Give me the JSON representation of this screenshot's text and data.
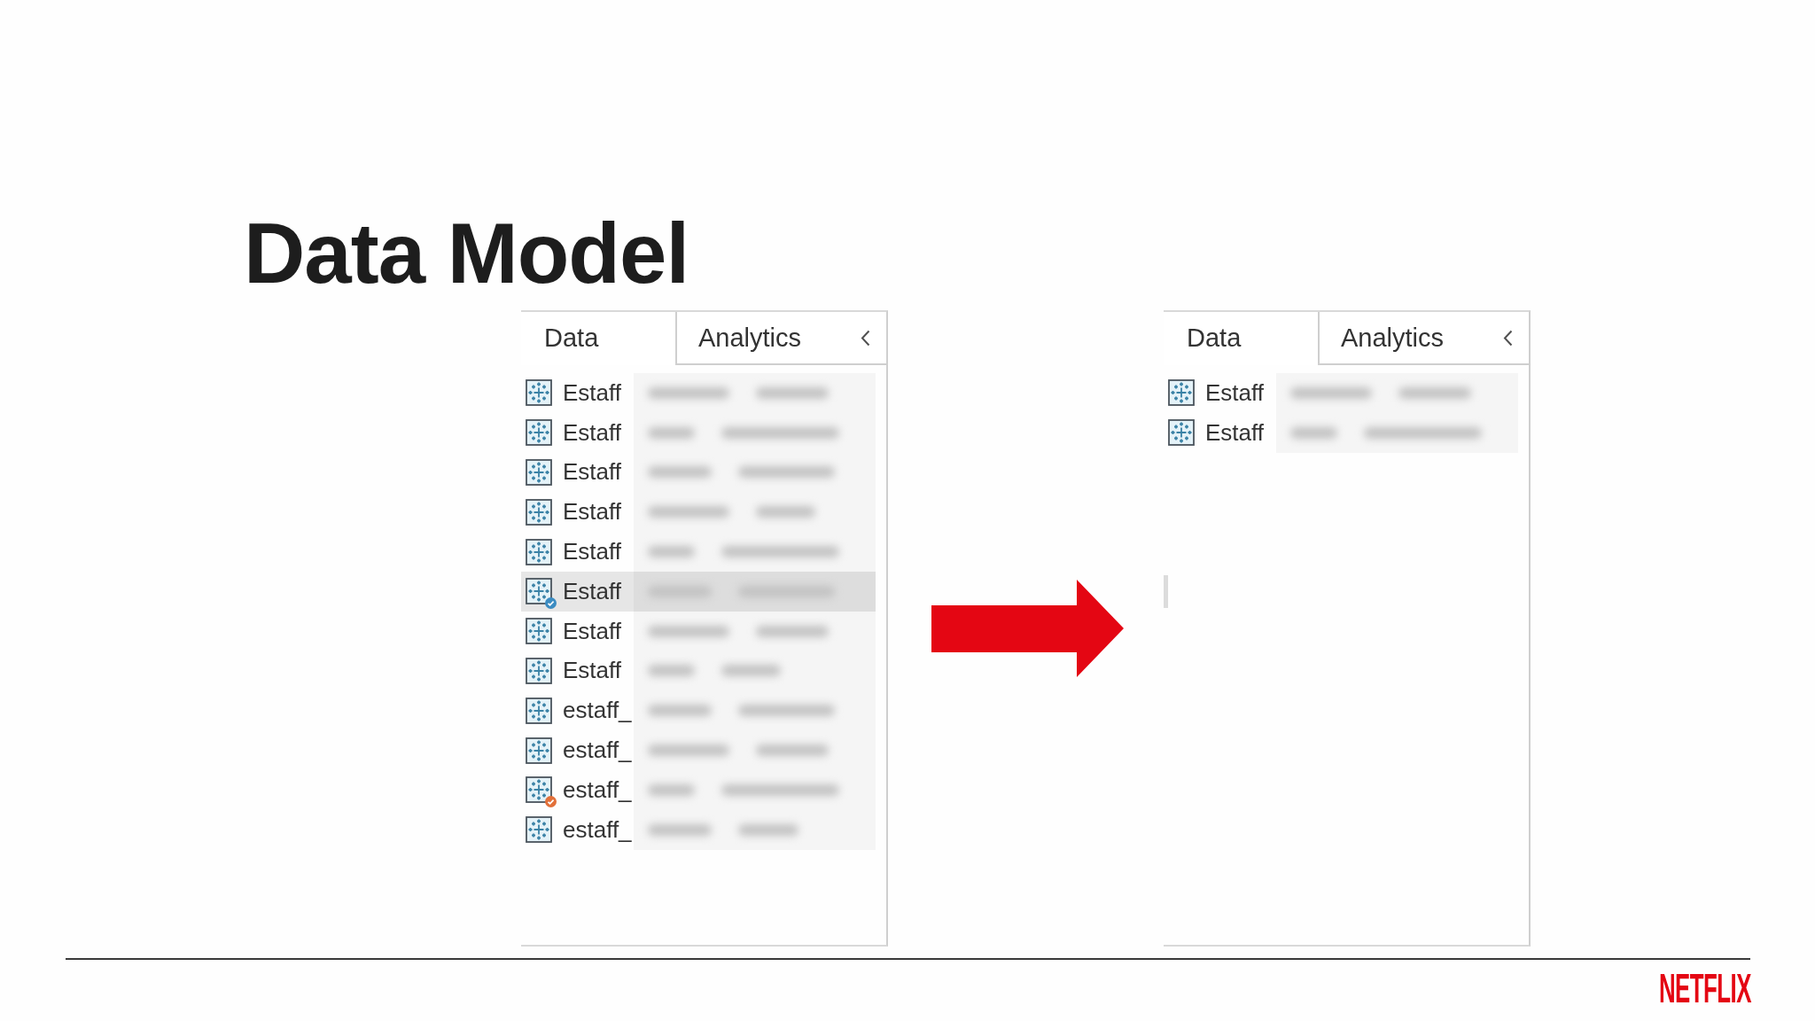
{
  "title": "Data Model",
  "panels": [
    {
      "tabs": [
        {
          "label": "Data",
          "selected": true
        },
        {
          "label": "Analytics",
          "selected": false
        }
      ],
      "items": [
        {
          "label": "Estaff",
          "selected": false
        },
        {
          "label": "Estaff",
          "selected": false
        },
        {
          "label": "Estaff",
          "selected": false
        },
        {
          "label": "Estaff",
          "selected": false
        },
        {
          "label": "Estaff",
          "selected": false
        },
        {
          "label": "Estaff",
          "selected": true,
          "badge": {
            "color": "#3b8cc2"
          }
        },
        {
          "label": "Estaff",
          "selected": false
        },
        {
          "label": "Estaff",
          "selected": false
        },
        {
          "label": "estaff_",
          "selected": false
        },
        {
          "label": "estaff_",
          "selected": false
        },
        {
          "label": "estaff_",
          "selected": false,
          "badge": {
            "color": "#e2703a"
          }
        },
        {
          "label": "estaff_",
          "selected": false
        }
      ]
    },
    {
      "tabs": [
        {
          "label": "Data",
          "selected": true
        },
        {
          "label": "Analytics",
          "selected": false
        }
      ],
      "items": [
        {
          "label": "Estaff",
          "selected": false
        },
        {
          "label": "Estaff",
          "selected": false
        }
      ]
    }
  ],
  "footer": {
    "logo": "NETFLIX"
  }
}
